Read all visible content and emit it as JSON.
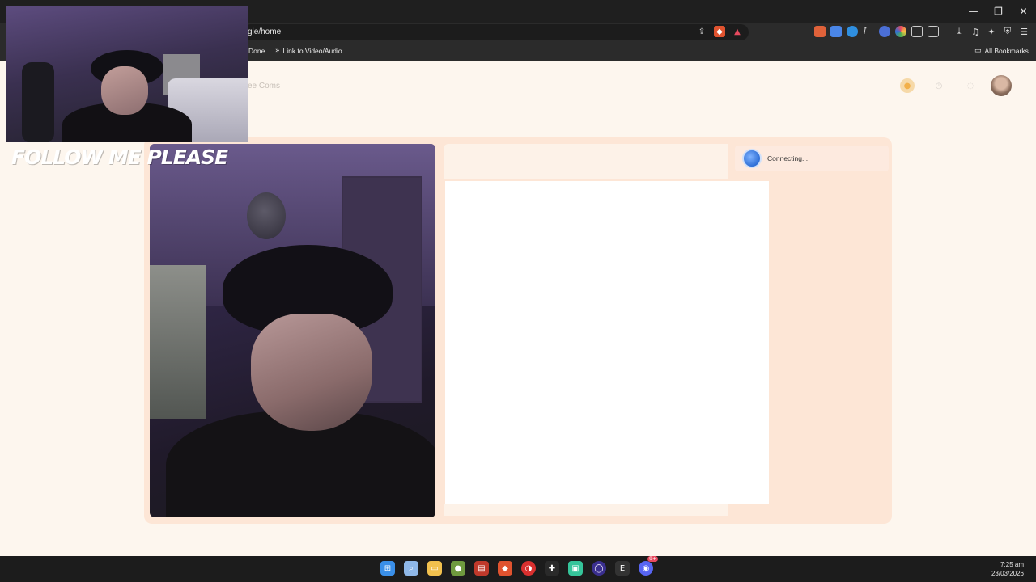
{
  "browser": {
    "url": "gle/home",
    "window_controls": [
      "—",
      "❐",
      "✕"
    ],
    "url_icons": [
      "share-icon",
      "brave-shield-icon",
      "brave-rewards-icon"
    ],
    "extension_icons": [
      "ext-icon-1",
      "translate-icon",
      "ext-icon-3",
      "font-icon",
      "ext-icon-5",
      "color-icon",
      "puzzle-icon",
      "sidebar-icon"
    ],
    "tool_icons": [
      "download-icon",
      "music-icon",
      "leo-icon",
      "vpn-icon",
      "menu-icon"
    ]
  },
  "bookmarks": {
    "item1": "Done",
    "item2": "Link to Video/Audio",
    "all": "All Bookmarks"
  },
  "page": {
    "title": "ee Coms",
    "status": "Connecting..."
  },
  "overlay": {
    "follow_text": "FOLLOW ME PLEASE"
  },
  "taskbar": {
    "time": "7:25 am",
    "date": "23/03/2026",
    "discord_badge": "9+"
  },
  "colors": {
    "page_bg": "#fdf6ee",
    "panel_bg": "#fde6d6",
    "accent_blue": "#2f6fd6",
    "taskbar_bg": "#1c1c1c"
  }
}
